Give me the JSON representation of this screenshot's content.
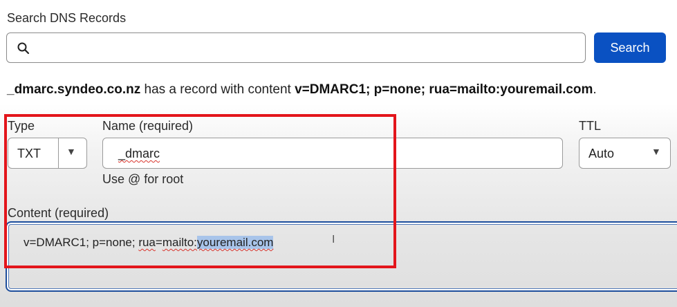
{
  "search": {
    "label": "Search DNS Records",
    "placeholder": "",
    "button_label": "Search"
  },
  "result": {
    "record_name": "_dmarc.syndeo.co.nz",
    "middle_text": " has a record with content ",
    "record_content": "v=DMARC1; p=none; rua=mailto:youremail.com",
    "end_text": "."
  },
  "form": {
    "type": {
      "label": "Type",
      "value": "TXT"
    },
    "name": {
      "label": "Name (required)",
      "value": "_dmarc",
      "hint": "Use @ for root"
    },
    "ttl": {
      "label": "TTL",
      "value": "Auto"
    },
    "content": {
      "label": "Content (required)",
      "text_part1": "v=DMARC1; p=none; ",
      "text_part2": "rua",
      "text_part3": "=",
      "text_part4": "mailto:",
      "text_selected": "youremail.com"
    }
  },
  "colors": {
    "accent": "#0a51c2",
    "highlight": "#e3151b",
    "focus_border": "#1d4e9c",
    "selection": "#a8c4ea"
  },
  "icons": {
    "search": "search-icon",
    "dropdown": "caret-down-icon",
    "cursor": "text-cursor-icon"
  }
}
